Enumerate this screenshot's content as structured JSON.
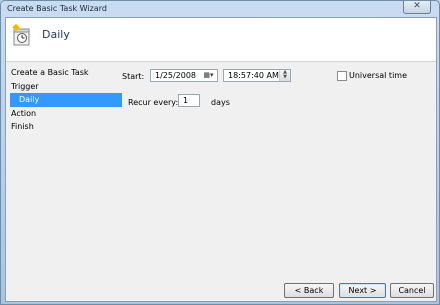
{
  "window": {
    "title": "Create Basic Task Wizard",
    "close_label": "✕"
  },
  "header": {
    "title": "Daily",
    "icon": "task-scheduler-icon"
  },
  "nav": {
    "items": [
      {
        "label": "Create a Basic Task"
      },
      {
        "label": "Trigger"
      },
      {
        "label": "Daily"
      },
      {
        "label": "Action"
      },
      {
        "label": "Finish"
      }
    ]
  },
  "form": {
    "start_label": "Start:",
    "start_date": "1/25/2008",
    "start_time": "18:57:40 AM",
    "universal_time_label": "Universal time",
    "universal_time_checked": false,
    "recur_label": "Recur every:",
    "recur_value": "1",
    "recur_unit": "days"
  },
  "buttons": {
    "back": "< Back",
    "next": "Next >",
    "cancel": "Cancel"
  }
}
